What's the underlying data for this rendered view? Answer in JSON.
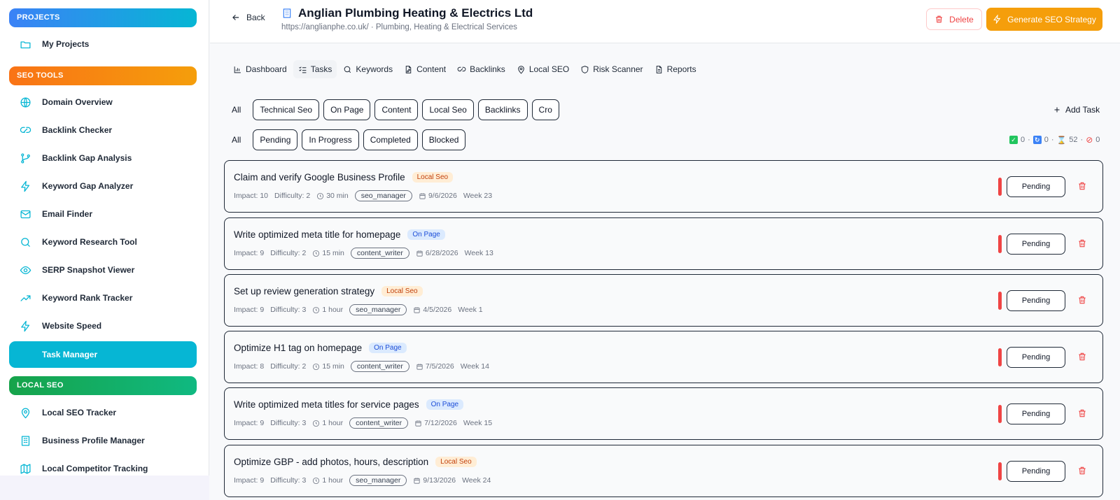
{
  "sidebar": {
    "sections": {
      "projects": "PROJECTS",
      "seo_tools": "SEO TOOLS",
      "local_seo": "LOCAL SEO"
    },
    "items": [
      {
        "label": "My Projects",
        "icon": "folder-icon"
      },
      {
        "label": "Domain Overview",
        "icon": "globe-icon"
      },
      {
        "label": "Backlink Checker",
        "icon": "link-icon"
      },
      {
        "label": "Backlink Gap Analysis",
        "icon": "git-branch-icon"
      },
      {
        "label": "Keyword Gap Analyzer",
        "icon": "zap-icon"
      },
      {
        "label": "Email Finder",
        "icon": "mail-icon"
      },
      {
        "label": "Keyword Research Tool",
        "icon": "search-icon"
      },
      {
        "label": "SERP Snapshot Viewer",
        "icon": "eye-icon"
      },
      {
        "label": "Keyword Rank Tracker",
        "icon": "trending-up-icon"
      },
      {
        "label": "Website Speed",
        "icon": "zap-icon"
      },
      {
        "label": "Task Manager",
        "icon": "list-icon"
      },
      {
        "label": "Local SEO Tracker",
        "icon": "map-pin-icon"
      },
      {
        "label": "Business Profile Manager",
        "icon": "building-icon"
      },
      {
        "label": "Local Competitor Tracking",
        "icon": "map-icon"
      }
    ]
  },
  "header": {
    "back_label": "Back",
    "title": "Anglian Plumbing Heating & Electrics Ltd",
    "subtitle": "https://anglianphe.co.uk/ · Plumbing, Heating & Electrical Services",
    "delete_label": "Delete",
    "generate_label": "Generate SEO Strategy"
  },
  "tabs": [
    "Dashboard",
    "Tasks",
    "Keywords",
    "Content",
    "Backlinks",
    "Local SEO",
    "Risk Scanner",
    "Reports"
  ],
  "category_filters": [
    "All",
    "Technical Seo",
    "On Page",
    "Content",
    "Local Seo",
    "Backlinks",
    "Cro"
  ],
  "status_filters": [
    "All",
    "Pending",
    "In Progress",
    "Completed",
    "Blocked"
  ],
  "add_task_label": "Add Task",
  "stats": {
    "completed": "0",
    "in_progress": "0",
    "pending": "52",
    "blocked": "0",
    "sep": "·"
  },
  "tasks": [
    {
      "title": "Claim and verify Google Business Profile",
      "tag": "Local Seo",
      "impact": "Impact: 10",
      "difficulty": "Difficulty: 2",
      "time": "30 min",
      "role": "seo_manager",
      "date": "9/6/2026",
      "week": "Week 23",
      "status": "Pending"
    },
    {
      "title": "Write optimized meta title for homepage",
      "tag": "On Page",
      "impact": "Impact: 9",
      "difficulty": "Difficulty: 2",
      "time": "15 min",
      "role": "content_writer",
      "date": "6/28/2026",
      "week": "Week 13",
      "status": "Pending"
    },
    {
      "title": "Set up review generation strategy",
      "tag": "Local Seo",
      "impact": "Impact: 9",
      "difficulty": "Difficulty: 3",
      "time": "1 hour",
      "role": "seo_manager",
      "date": "4/5/2026",
      "week": "Week 1",
      "status": "Pending"
    },
    {
      "title": "Optimize H1 tag on homepage",
      "tag": "On Page",
      "impact": "Impact: 8",
      "difficulty": "Difficulty: 2",
      "time": "15 min",
      "role": "content_writer",
      "date": "7/5/2026",
      "week": "Week 14",
      "status": "Pending"
    },
    {
      "title": "Write optimized meta titles for service pages",
      "tag": "On Page",
      "impact": "Impact: 9",
      "difficulty": "Difficulty: 3",
      "time": "1 hour",
      "role": "content_writer",
      "date": "7/12/2026",
      "week": "Week 15",
      "status": "Pending"
    },
    {
      "title": "Optimize GBP - add photos, hours, description",
      "tag": "Local Seo",
      "impact": "Impact: 9",
      "difficulty": "Difficulty: 3",
      "time": "1 hour",
      "role": "seo_manager",
      "date": "9/13/2026",
      "week": "Week 24",
      "status": "Pending"
    }
  ],
  "colors": {
    "accent": "#06b6d4",
    "generate": "#f59e0b",
    "danger": "#ef4444",
    "local_tag_bg": "#ffedd5",
    "onpage_tag_bg": "#dbeafe"
  }
}
